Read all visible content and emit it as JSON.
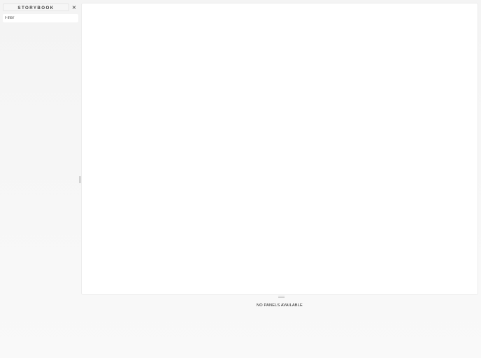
{
  "sidebar": {
    "brand_label": "STORYBOOK",
    "shortcuts_icon": "×",
    "filter_placeholder": "Filter"
  },
  "addons": {
    "empty_message": "NO PANELS AVAILABLE"
  }
}
